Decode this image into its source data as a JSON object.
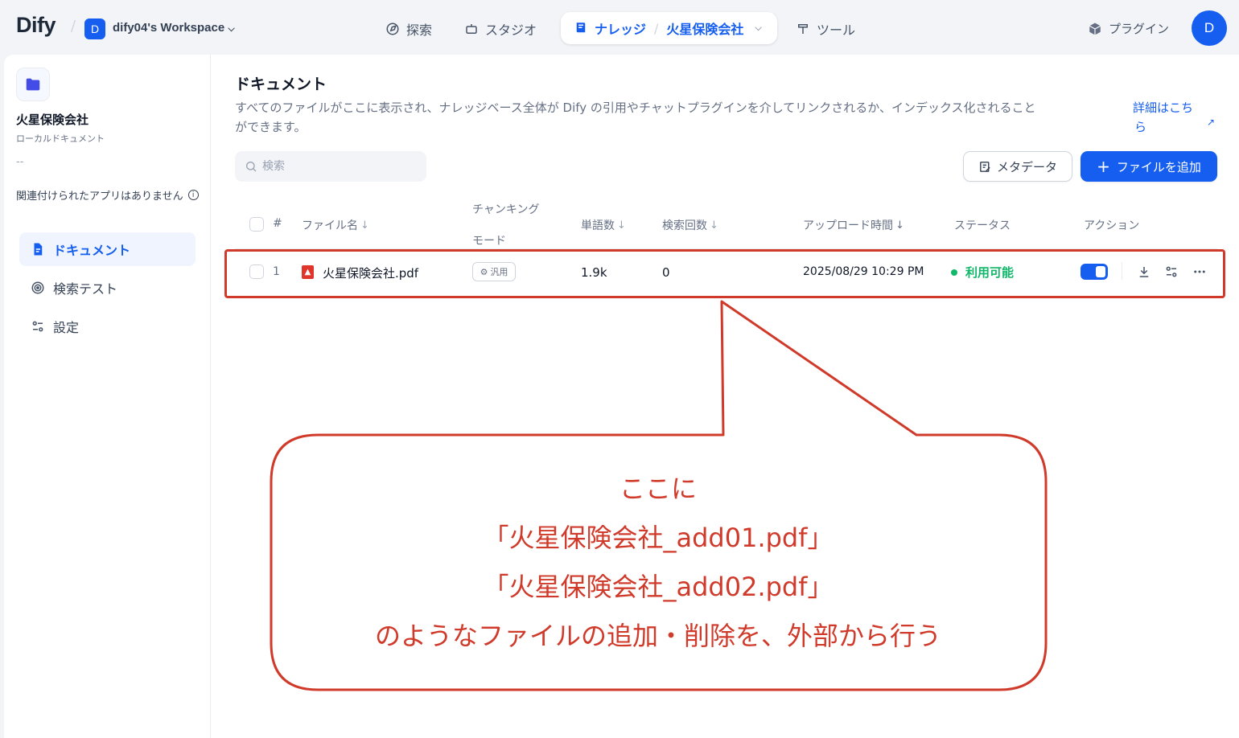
{
  "topbar": {
    "logo": "Dify",
    "workspace_initial": "D",
    "workspace_name": "dify04's Workspace",
    "nav": {
      "explore": "探索",
      "studio": "スタジオ",
      "knowledge": "ナレッジ",
      "current_dataset": "火星保険会社",
      "tools": "ツール"
    },
    "plugins": "プラグイン",
    "user_initial": "D"
  },
  "sidebar": {
    "dataset_name": "火星保険会社",
    "dataset_type": "ローカルドキュメント",
    "description": "--",
    "no_linked_apps": "関連付けられたアプリはありません",
    "items": [
      {
        "label": "ドキュメント",
        "icon": "document-icon"
      },
      {
        "label": "検索テスト",
        "icon": "target-icon"
      },
      {
        "label": "設定",
        "icon": "settings-icon"
      }
    ]
  },
  "main": {
    "title": "ドキュメント",
    "description_line1": "すべてのファイルがここに表示され、ナレッジベース全体が Dify の引用やチャットプラグインを介してリンクされるか、インデックス化されること",
    "description_line2": "ができます。",
    "learn_more_line1": "詳細はこち",
    "learn_more_line2": "ら",
    "search_placeholder": "検索",
    "metadata_button": "メタデータ",
    "add_file_button": "ファイルを追加"
  },
  "table": {
    "headers": {
      "index": "#",
      "filename": "ファイル名",
      "chunk_mode_line1": "チャンキング",
      "chunk_mode_line2": "モード",
      "words": "単語数",
      "hits": "検索回数",
      "upload_time": "アップロード時間",
      "status": "ステータス",
      "actions": "アクション"
    },
    "rows": [
      {
        "index": "1",
        "filename": "火星保険会社.pdf",
        "chunk_mode": "汎用",
        "words": "1.9k",
        "hits": "0",
        "upload_time": "2025/08/29 10:29 PM",
        "status": "利用可能",
        "enabled": true
      }
    ]
  },
  "annotation": {
    "line1": "ここに",
    "line2": "「火星保険会社_add01.pdf」",
    "line3": "「火星保険会社_add02.pdf」",
    "line4": "のようなファイルの追加・削除を、外部から行う",
    "color": "#d03a2a"
  },
  "colors": {
    "accent": "#155eef",
    "success": "#12b76a",
    "annotation": "#d03a2a"
  }
}
